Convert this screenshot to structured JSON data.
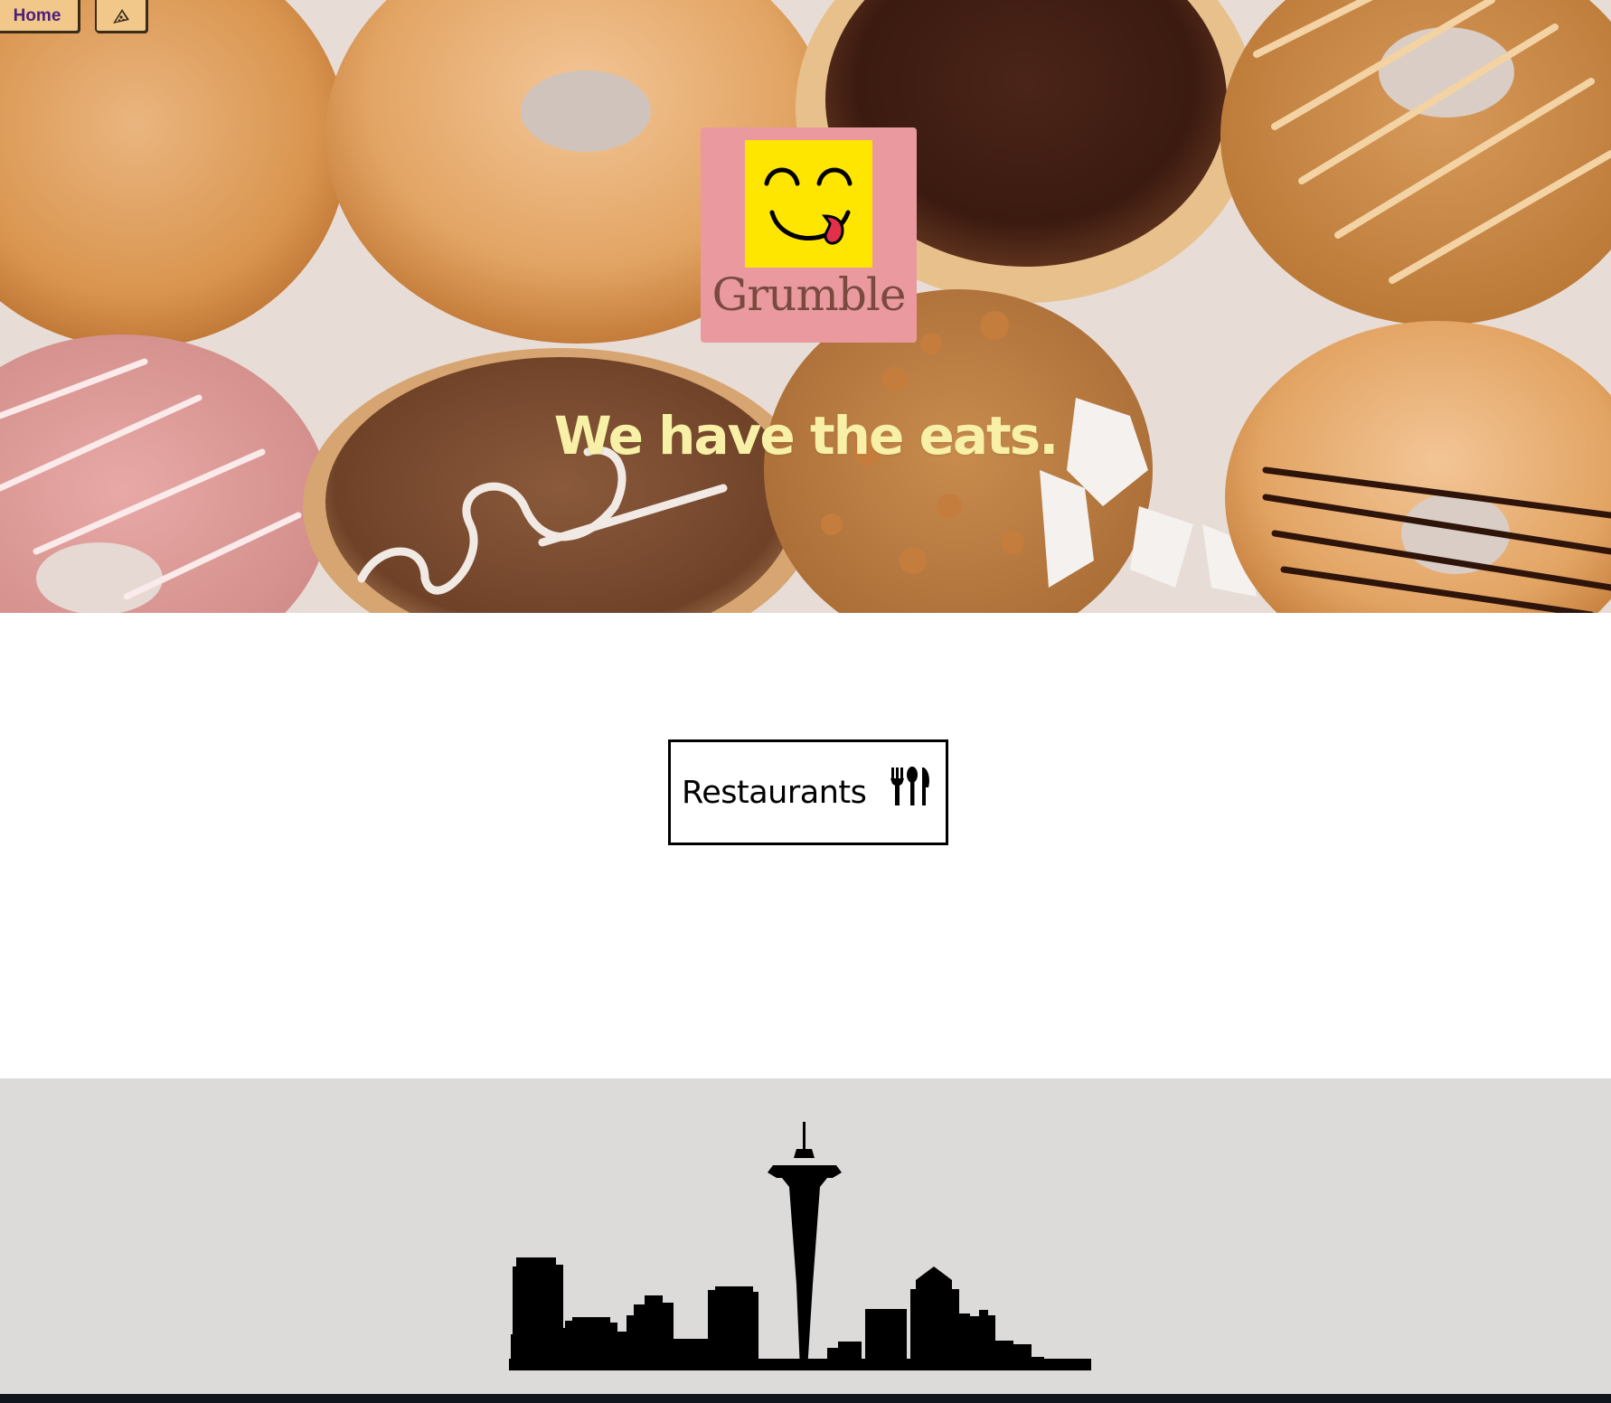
{
  "nav": {
    "home_label": "Home",
    "pizza_icon": "pizza-slice-icon"
  },
  "brand": {
    "name": "Grumble",
    "logo_icon": "yum-face-icon",
    "logo_bg_color": "#ea9a9e",
    "logo_face_color": "#ffe600"
  },
  "hero": {
    "tagline": "We have the eats.",
    "tagline_color": "#f7f0a6",
    "background_image": "donuts-photo"
  },
  "main": {
    "restaurants_label": "Restaurants",
    "restaurants_icon": "utensils-icon"
  },
  "footer": {
    "illustration": "seattle-skyline-icon",
    "background_color": "#dddada"
  }
}
